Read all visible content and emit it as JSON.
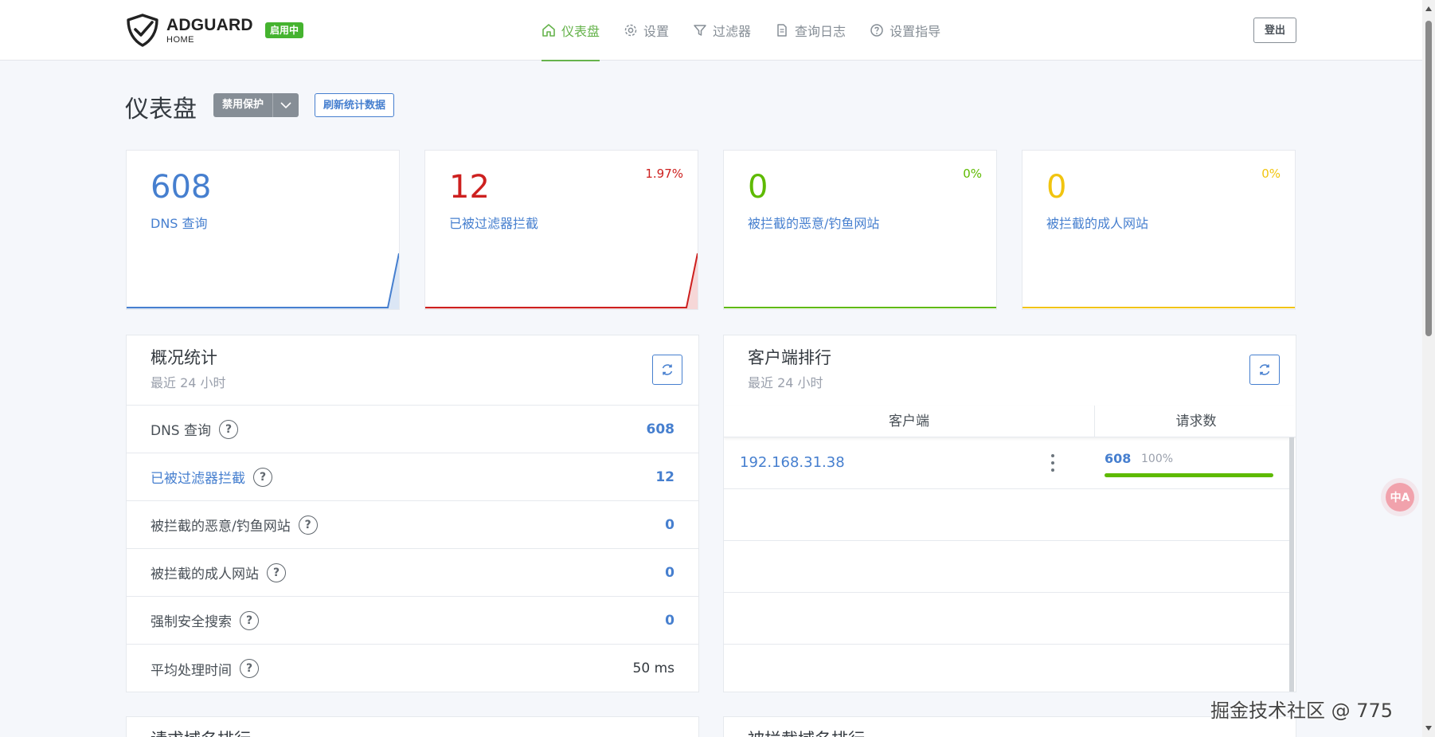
{
  "header": {
    "logo_main": "ADGUARD",
    "logo_sub": "HOME",
    "status_badge": "启用中",
    "nav": [
      {
        "label": "仪表盘",
        "icon": "home-icon",
        "active": true
      },
      {
        "label": "设置",
        "icon": "gear-icon",
        "active": false
      },
      {
        "label": "过滤器",
        "icon": "filter-icon",
        "active": false
      },
      {
        "label": "查询日志",
        "icon": "document-icon",
        "active": false
      },
      {
        "label": "设置指导",
        "icon": "help-circle-icon",
        "active": false
      }
    ],
    "logout_label": "登出"
  },
  "page": {
    "title": "仪表盘",
    "disable_label": "禁用保护",
    "refresh_label": "刷新统计数据"
  },
  "cards": [
    {
      "value": "608",
      "label": "DNS 查询",
      "percent": "",
      "color": "#467fcf"
    },
    {
      "value": "12",
      "label": "已被过滤器拦截",
      "percent": "1.97%",
      "color": "#cd201f"
    },
    {
      "value": "0",
      "label": "被拦截的恶意/钓鱼网站",
      "percent": "0%",
      "color": "#5eba00"
    },
    {
      "value": "0",
      "label": "被拦截的成人网站",
      "percent": "0%",
      "color": "#f1c40f"
    }
  ],
  "overview": {
    "title": "概况统计",
    "subtitle": "最近 24 小时",
    "rows": [
      {
        "name": "DNS 查询",
        "value": "608",
        "link": false,
        "value_dark": false
      },
      {
        "name": "已被过滤器拦截",
        "value": "12",
        "link": true,
        "value_dark": false
      },
      {
        "name": "被拦截的恶意/钓鱼网站",
        "value": "0",
        "link": false,
        "value_dark": false
      },
      {
        "name": "被拦截的成人网站",
        "value": "0",
        "link": false,
        "value_dark": false
      },
      {
        "name": "强制安全搜索",
        "value": "0",
        "link": false,
        "value_dark": false
      },
      {
        "name": "平均处理时间",
        "value": "50 ms",
        "link": false,
        "value_dark": true
      }
    ],
    "help_glyph": "?"
  },
  "clients": {
    "title": "客户端排行",
    "subtitle": "最近 24 小时",
    "col_client": "客户端",
    "col_requests": "请求数",
    "rows": [
      {
        "ip": "192.168.31.38",
        "count": "608",
        "percent": "100%",
        "fill": 1.0
      }
    ]
  },
  "bottom": {
    "left_title": "请求域名排行",
    "right_title": "被拦截域名排行"
  },
  "float_button": "中A",
  "watermark": "掘金技术社区 @ 775"
}
